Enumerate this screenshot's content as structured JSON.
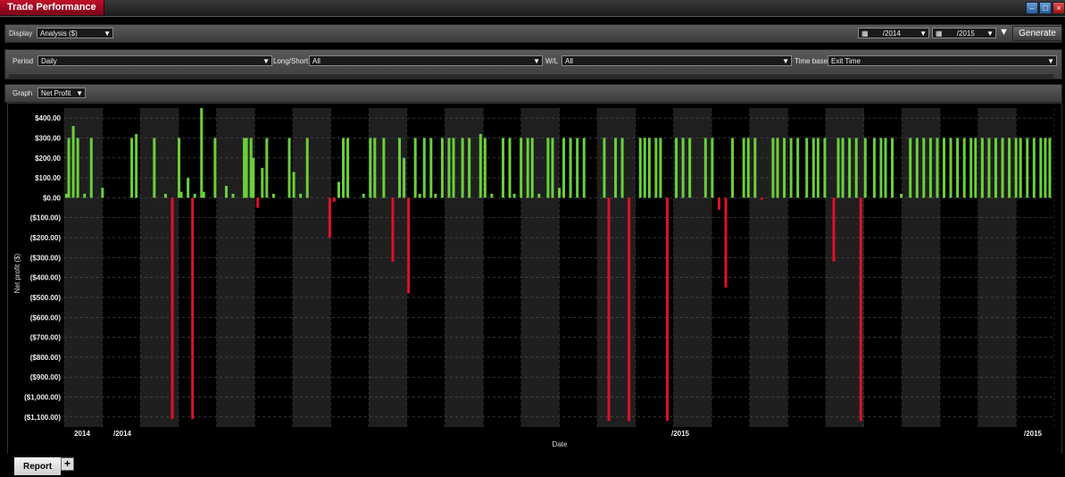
{
  "window": {
    "title": "Trade Performance"
  },
  "toolbar": {
    "display_label": "Display",
    "display_value": "Analysis ($)",
    "start_date": "/2014",
    "end_date": "/2015",
    "generate_label": "Generate"
  },
  "filters": {
    "period_label": "Period",
    "period_value": "Daily",
    "longshort_label": "Long/Short",
    "longshort_value": "All",
    "wl_label": "W/L",
    "wl_value": "All",
    "timebase_label": "Time base",
    "timebase_value": "Exit Time"
  },
  "graph": {
    "label": "Graph",
    "value": "Net Profit"
  },
  "tabs": {
    "report_label": "Report",
    "add_label": "+"
  },
  "colors": {
    "win": "#6ad03a",
    "loss": "#e0102a",
    "title_tab": "#b0102a"
  },
  "chart_data": {
    "type": "bar",
    "xlabel": "Date",
    "ylabel": "Net profit ($)",
    "ylim": [
      -1150,
      450
    ],
    "yticks": [
      400,
      300,
      200,
      100,
      0,
      -100,
      -200,
      -300,
      -400,
      -500,
      -600,
      -700,
      -800,
      -900,
      -1000,
      -1100
    ],
    "ytick_labels": [
      "$400.00",
      "$300.00",
      "$200.00",
      "$100.00",
      "$0.00",
      "($100.00)",
      "($200.00)",
      "($300.00)",
      "($400.00)",
      "($500.00)",
      "($600.00)",
      "($700.00)",
      "($800.00)",
      "($900.00)",
      "($1,000.00)",
      "($1,100.00)"
    ],
    "xtick_labels": [
      "2014",
      "/2014",
      "/2015",
      "/2015"
    ],
    "x_index_max": 440,
    "x": [
      1,
      2,
      4,
      6,
      9,
      12,
      17,
      30,
      32,
      40,
      45,
      48,
      51,
      52,
      55,
      57,
      58,
      61,
      62,
      67,
      72,
      75,
      80,
      81,
      83,
      84,
      86,
      88,
      90,
      93,
      100,
      102,
      105,
      108,
      118,
      120,
      122,
      124,
      126,
      133,
      136,
      138,
      142,
      146,
      149,
      151,
      153,
      156,
      158,
      160,
      163,
      165,
      168,
      171,
      173,
      177,
      180,
      185,
      187,
      190,
      195,
      198,
      200,
      203,
      206,
      208,
      211,
      215,
      217,
      220,
      222,
      225,
      228,
      231,
      240,
      242,
      245,
      248,
      251,
      256,
      258,
      260,
      263,
      265,
      268,
      272,
      275,
      278,
      285,
      288,
      291,
      294,
      297,
      302,
      304,
      307,
      310,
      315,
      317,
      320,
      323,
      326,
      330,
      333,
      335,
      338,
      342,
      344,
      346,
      349,
      352,
      354,
      356,
      360,
      363,
      365,
      368,
      372,
      376,
      379,
      382,
      385,
      388,
      391,
      394,
      397,
      400,
      403,
      405,
      408,
      411,
      414,
      417,
      420,
      423,
      425,
      428,
      431,
      434,
      436,
      438
    ],
    "values": [
      20,
      300,
      360,
      300,
      20,
      300,
      50,
      300,
      320,
      300,
      20,
      -1110,
      300,
      30,
      100,
      -1110,
      20,
      450,
      30,
      300,
      60,
      20,
      300,
      300,
      300,
      200,
      -50,
      150,
      300,
      20,
      300,
      130,
      20,
      300,
      -200,
      -20,
      80,
      300,
      300,
      20,
      300,
      300,
      300,
      -320,
      300,
      200,
      -480,
      300,
      20,
      300,
      300,
      20,
      300,
      300,
      300,
      300,
      300,
      320,
      300,
      20,
      300,
      300,
      20,
      300,
      300,
      300,
      20,
      300,
      300,
      50,
      300,
      300,
      300,
      300,
      300,
      -1120,
      300,
      300,
      -1120,
      300,
      300,
      300,
      300,
      300,
      -1120,
      300,
      300,
      300,
      300,
      300,
      -60,
      -450,
      300,
      300,
      300,
      300,
      -10,
      300,
      300,
      300,
      300,
      300,
      300,
      300,
      300,
      300,
      -320,
      300,
      300,
      300,
      300,
      -1120,
      300,
      300,
      300,
      300,
      300,
      20,
      300,
      300,
      300,
      300,
      300,
      300,
      300,
      300,
      300,
      300,
      300,
      300,
      300,
      300,
      300,
      300,
      300,
      300,
      300,
      300,
      300,
      300,
      300,
      300
    ]
  }
}
